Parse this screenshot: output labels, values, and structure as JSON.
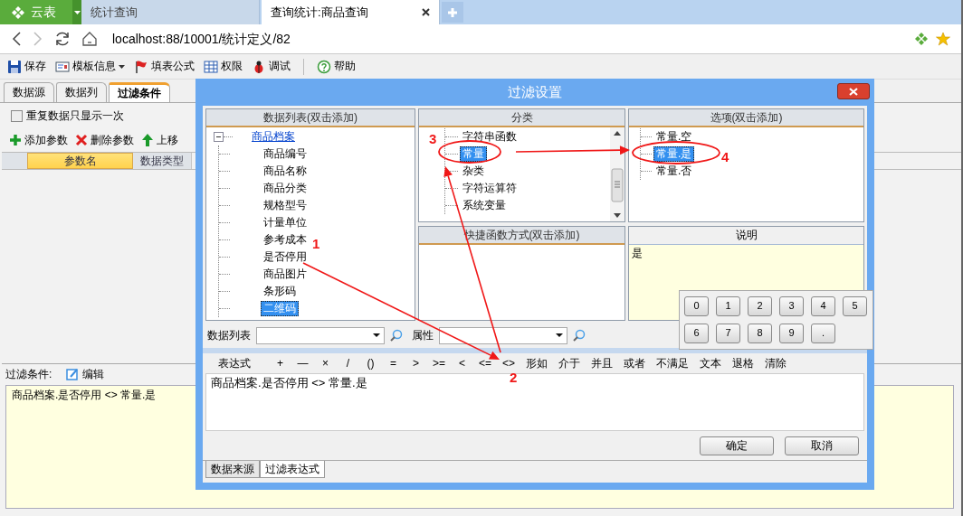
{
  "browser": {
    "logo": "云表",
    "tabs": [
      {
        "label": "统计查询",
        "selected": false
      },
      {
        "label": "查询统计:商品查询",
        "selected": true
      }
    ],
    "address": "localhost:88/10001/统计定义/82"
  },
  "toolbar": [
    {
      "label": "保存",
      "dropdown": false
    },
    {
      "label": "模板信息",
      "dropdown": true
    },
    {
      "label": "填表公式",
      "dropdown": false
    },
    {
      "label": "权限",
      "dropdown": false
    },
    {
      "label": "调试",
      "dropdown": false
    },
    {
      "label": "帮助",
      "dropdown": false
    }
  ],
  "left_panel": {
    "tabs": [
      {
        "label": "数据源",
        "selected": false
      },
      {
        "label": "数据列",
        "selected": false
      },
      {
        "label": "过滤条件",
        "selected": true
      }
    ],
    "checkbox": {
      "label": "重复数据只显示一次",
      "checked": false
    },
    "actions": [
      "添加参数",
      "删除参数",
      "上移"
    ],
    "columns": [
      {
        "label": "参数名",
        "selected": true
      },
      {
        "label": "数据类型",
        "selected": false
      }
    ],
    "filter_label": "过滤条件:",
    "edit": "编辑",
    "filter_text": "商品档案.是否停用 <> 常量.是"
  },
  "dialog": {
    "title": "过滤设置",
    "data_list": {
      "header": "数据列表(双击添加)",
      "tree": [
        {
          "label": "商品档案",
          "expanded": true,
          "selected": false,
          "children": [
            {
              "label": "商品编号",
              "selected": false
            },
            {
              "label": "商品名称",
              "selected": false
            },
            {
              "label": "商品分类",
              "selected": false
            },
            {
              "label": "规格型号",
              "selected": false
            },
            {
              "label": "计量单位",
              "selected": false
            },
            {
              "label": "参考成本",
              "selected": false
            },
            {
              "label": "是否停用",
              "selected": false
            },
            {
              "label": "商品图片",
              "selected": false
            },
            {
              "label": "条形码",
              "selected": false
            },
            {
              "label": "二维码",
              "selected": true
            }
          ]
        }
      ]
    },
    "category": {
      "header": "分类",
      "items": [
        {
          "label": "字符串函数",
          "selected": false
        },
        {
          "label": "常量",
          "selected": true
        },
        {
          "label": "杂类",
          "selected": false
        },
        {
          "label": "字符运算符",
          "selected": false
        },
        {
          "label": "系统变量",
          "selected": false
        }
      ]
    },
    "options": {
      "header": "选项(双击添加)",
      "items": [
        {
          "label": "常量.空",
          "selected": false
        },
        {
          "label": "常量.是",
          "selected": true
        },
        {
          "label": "常量.否",
          "selected": false
        }
      ]
    },
    "shortcut": {
      "header": "快捷函数方式(双击添加)"
    },
    "description": {
      "header": "说明",
      "text": "是"
    },
    "data_list_label": "数据列表",
    "property_label": "属性",
    "operators": [
      "表达式",
      "+",
      "—",
      "×",
      "/",
      "()",
      "=",
      ">",
      ">=",
      "<",
      "<=",
      "<>",
      "形如",
      "介于",
      "并且",
      "或者",
      "不满足",
      "文本",
      "退格",
      "清除"
    ],
    "expression": "商品档案.是否停用 <> 常量.是",
    "buttons": [
      "确定",
      "取消"
    ],
    "bottom_tabs": [
      {
        "label": "数据来源",
        "selected": false
      },
      {
        "label": "过滤表达式",
        "selected": true
      }
    ],
    "keypad": [
      "0",
      "1",
      "2",
      "3",
      "4",
      "5",
      "6",
      "7",
      "8",
      "9",
      "."
    ]
  },
  "annotations": [
    {
      "label": "1"
    },
    {
      "label": "2"
    },
    {
      "label": "3"
    },
    {
      "label": "4"
    }
  ]
}
